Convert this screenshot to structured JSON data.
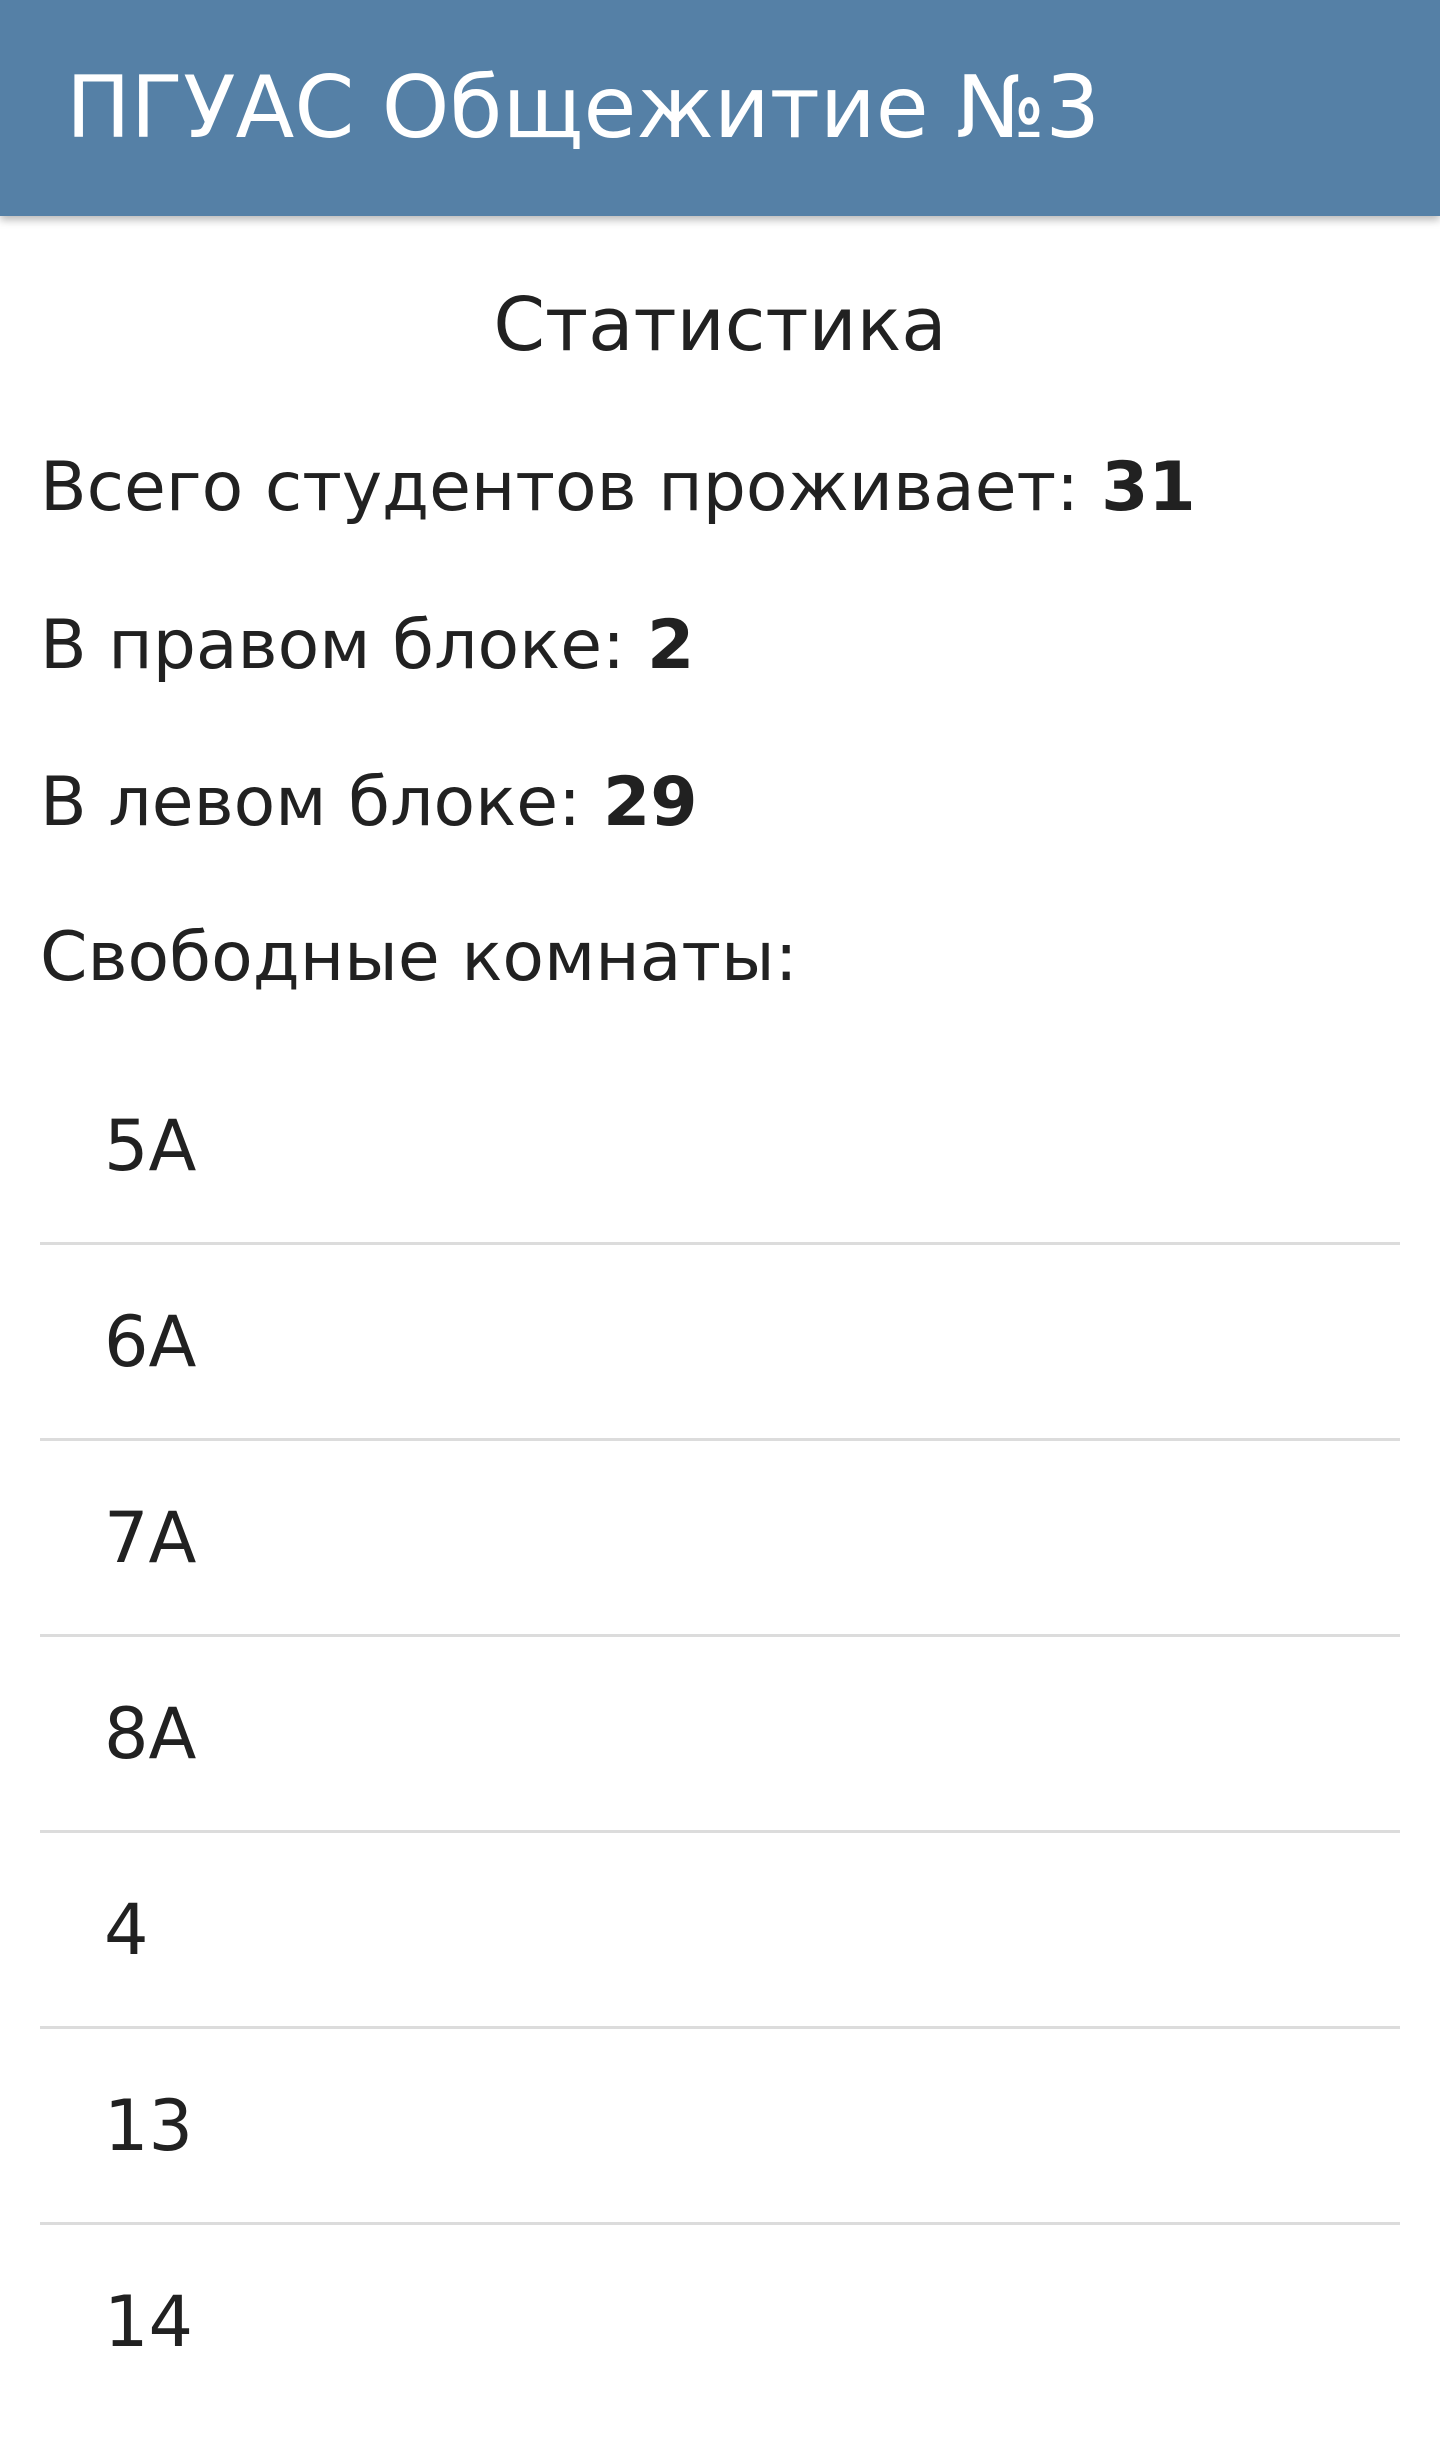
{
  "toolbar": {
    "title": "ПГУАС Общежитие №3"
  },
  "statistics": {
    "title": "Статистика",
    "total_label": "Всего студентов проживает:",
    "total_value": "31",
    "right_block_label": "В правом блоке:",
    "right_block_value": "2",
    "left_block_label": "В левом блоке:",
    "left_block_value": "29",
    "free_rooms_label": "Свободные комнаты:"
  },
  "free_rooms": [
    "5А",
    "6А",
    "7А",
    "8А",
    "4",
    "13",
    "14"
  ],
  "colors": {
    "toolbar_background": "#5580a6",
    "toolbar_text": "#ffffff",
    "body_text": "#212121",
    "divider": "#dcdcdc"
  }
}
